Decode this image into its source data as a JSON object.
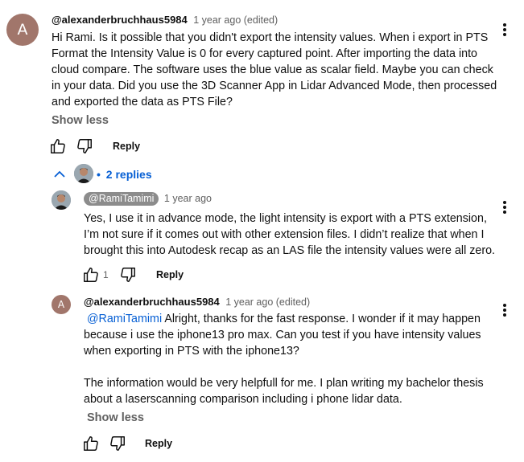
{
  "comment1": {
    "avatar_letter": "A",
    "handle": "@alexanderbruchhaus5984",
    "time": "1 year ago (edited)",
    "lines": [
      "Hi Rami. Is it possible that you didn't export the intensity values. When i export in PTS",
      "Format the Intensity Value is 0 for every captured point. After importing the data into",
      "cloud compare. The software uses the blue value as scalar field. Maybe you can check",
      "in your data. Did you use the 3D Scanner App in Lidar Advanced Mode, then processed",
      "and exported the data as PTS File?"
    ],
    "show_less": "Show less",
    "reply_label": "Reply"
  },
  "replies_toggle": {
    "label": "2 replies",
    "bullet": "•"
  },
  "reply1": {
    "handle": "@RamiTamimi",
    "time": "1 year ago",
    "lines": [
      "Yes, I use it in advance mode, the light intensity is export with a PTS extension,",
      "I’m not sure if it comes out with other extension files. I didn’t realize that when I",
      "brought this into Autodesk recap as an LAS file the intensity values were all zero."
    ],
    "like_count": "1",
    "reply_label": "Reply"
  },
  "reply2": {
    "avatar_letter": "A",
    "handle": "@alexanderbruchhaus5984",
    "time": "1 year ago (edited)",
    "mention": "@RamiTamimi",
    "first_line_rest": " Alright, thanks for the fast response. I wonder if it may happen",
    "lines": [
      "because i use the iphone13 pro max. Can you test if you have intensity values",
      "when exporting in PTS with the iphone13?"
    ],
    "paragraph2": [
      "The information would be very helpfull for me. I plan writing my bachelor thesis",
      "about a laserscanning comparison including i phone lidar data."
    ],
    "show_less": "Show less",
    "reply_label": "Reply"
  },
  "icons": {
    "like": "thumbs-up-icon",
    "dislike": "thumbs-down-icon",
    "menu": "more-vert-icon",
    "collapse": "chevron-up-icon"
  },
  "colors": {
    "avatar": "#a1766b",
    "link": "#065fd4",
    "secondary": "#606060"
  }
}
